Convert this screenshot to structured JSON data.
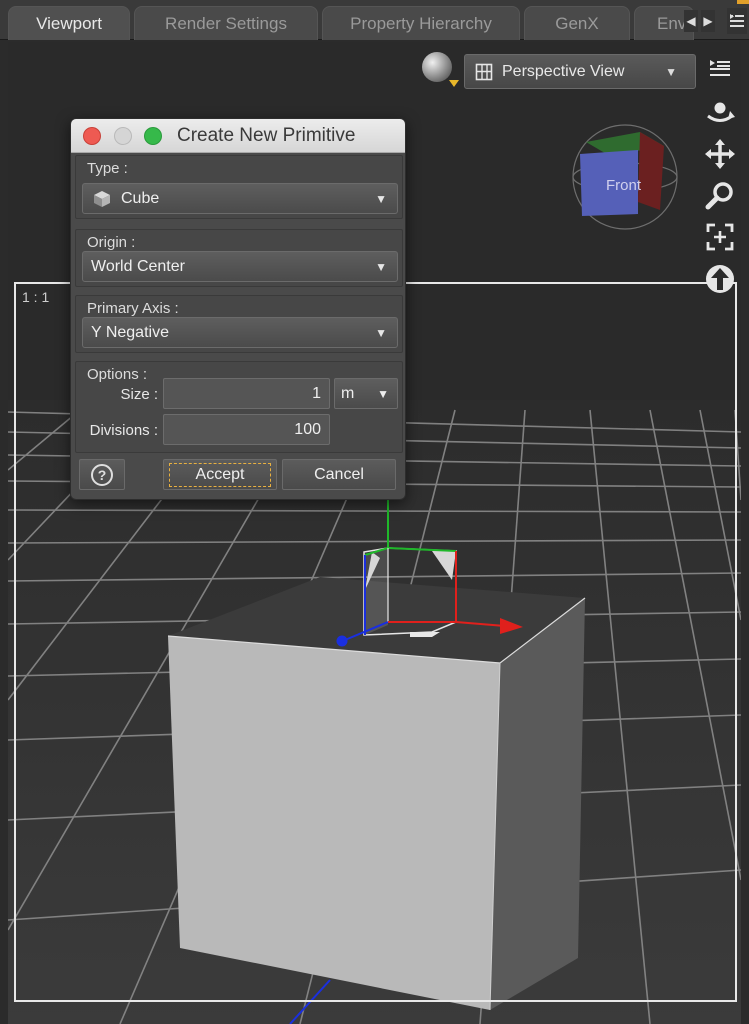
{
  "tabs": [
    {
      "label": "Viewport",
      "active": true
    },
    {
      "label": "Render Settings",
      "active": false
    },
    {
      "label": "Property Hierarchy",
      "active": false
    },
    {
      "label": "GenX",
      "active": false
    },
    {
      "label": "Env",
      "active": false
    }
  ],
  "viewport": {
    "view_mode": "Perspective View",
    "zoom_ratio": "1 : 1",
    "navcube_face": "Front"
  },
  "dialog": {
    "title": "Create New Primitive",
    "type_label": "Type :",
    "type_value": "Cube",
    "origin_label": "Origin :",
    "origin_value": "World Center",
    "axis_label": "Primary Axis :",
    "axis_value": "Y Negative",
    "options_label": "Options :",
    "size_label": "Size :",
    "size_value": "1",
    "size_unit": "m",
    "divisions_label": "Divisions :",
    "divisions_value": "100",
    "help_label": "?",
    "accept_label": "Accept",
    "cancel_label": "Cancel"
  },
  "colors": {
    "close": "#ee5a52",
    "minimize": "#d5d5d5",
    "zoom": "#36b94a",
    "accept_focus": "#e8b040",
    "x_axis": "#e0201c",
    "y_axis": "#1fb82a",
    "z_axis": "#1a2fe0"
  }
}
